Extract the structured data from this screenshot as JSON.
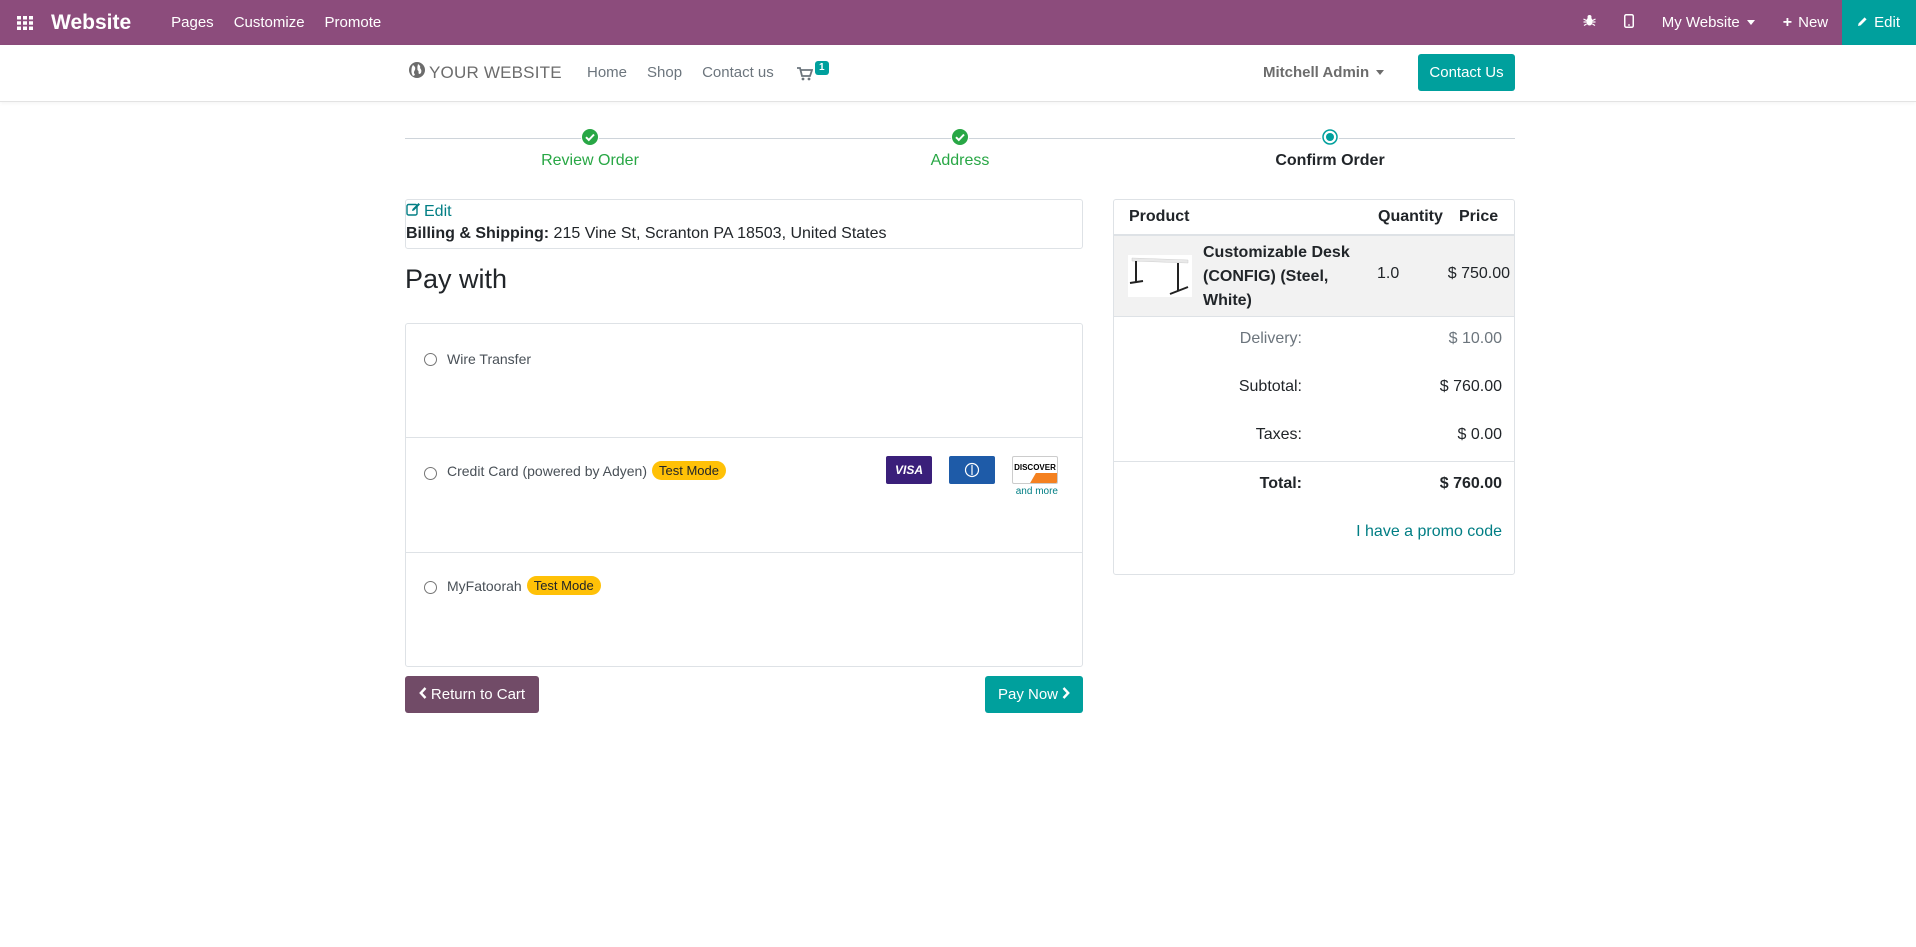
{
  "topbar": {
    "app_name": "Website",
    "menu": [
      "Pages",
      "Customize",
      "Promote"
    ],
    "website_switcher": "My Website",
    "new_label": "New",
    "edit_label": "Edit",
    "bg_color": "#8c4c7c",
    "edit_color": "#00a09d"
  },
  "header": {
    "logo_text": "YOUR WEBSITE",
    "nav": [
      "Home",
      "Shop",
      "Contact us"
    ],
    "cart_count": "1",
    "user": "Mitchell Admin",
    "contact_button": "Contact Us"
  },
  "steps": [
    {
      "label": "Review Order",
      "state": "done"
    },
    {
      "label": "Address",
      "state": "done"
    },
    {
      "label": "Confirm Order",
      "state": "current"
    }
  ],
  "address": {
    "edit_label": "Edit",
    "heading": "Billing & Shipping:",
    "value": "215 Vine St, Scranton PA 18503, United States"
  },
  "payment": {
    "title": "Pay with",
    "options": [
      {
        "label": "Wire Transfer",
        "badge": ""
      },
      {
        "label": "Credit Card (powered by Adyen)",
        "badge": "Test Mode",
        "cards": [
          "VISA",
          "Diners Club",
          "DISCOVER"
        ],
        "more": "and more"
      },
      {
        "label": "MyFatoorah",
        "badge": "Test Mode"
      }
    ],
    "return_button": "Return to Cart",
    "pay_button": "Pay Now"
  },
  "summary": {
    "headers": {
      "product": "Product",
      "quantity": "Quantity",
      "price": "Price"
    },
    "product": {
      "name": "Customizable Desk (CONFIG) (Steel, White)",
      "quantity": "1.0",
      "price": "$ 750.00"
    },
    "delivery": {
      "label": "Delivery:",
      "value": "$ 10.00"
    },
    "subtotal": {
      "label": "Subtotal:",
      "value": "$ 760.00"
    },
    "taxes": {
      "label": "Taxes:",
      "value": "$ 0.00"
    },
    "total": {
      "label": "Total:",
      "value": "$ 760.00"
    },
    "promo": "I have a promo code"
  }
}
